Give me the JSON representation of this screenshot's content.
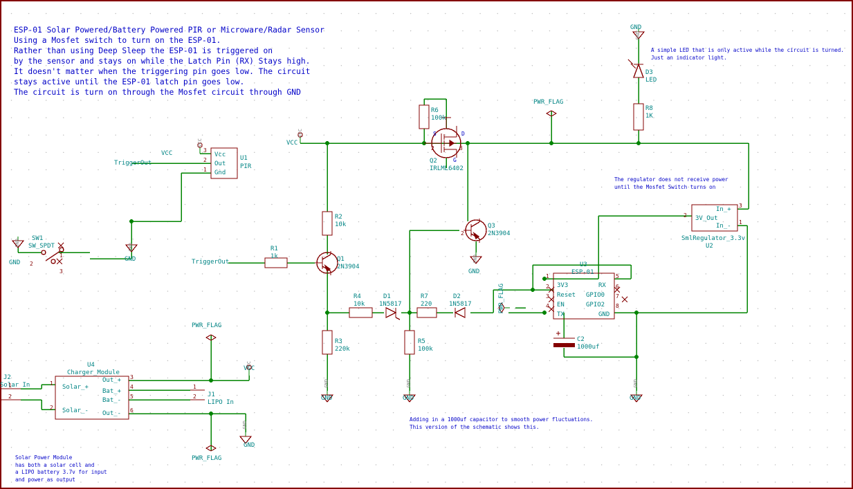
{
  "sheet": {
    "title_block": "ESP-01 Solar Powered/Battery Powered PIR or Microware/Radar Sensor\nUsing a Mosfet switch to turn on the ESP-01.\nRather than using Deep Sleep the ESP-01 is triggered on\nby the sensor and stays on while the Latch Pin (RX) Stays high.\nIt doesn't matter when the triggering pin goes low. The circuit\nstays active until the ESP-01 latch pin goes low.\nThe circuit is turn on through the Mosfet circuit through GND",
    "colors": {
      "wire": "#008400",
      "component": "#840000",
      "label": "#008484",
      "note": "#0000c8",
      "ground_gray": "#808080",
      "background": "#ffffff"
    }
  },
  "notes": {
    "led_note": "A simple LED that is only active while the circuit is turned.\nJust an indicator light.",
    "regulator_note": "The regulator does not receive power\nuntil the Mosfet Switch turns on",
    "capacitor_note": "Adding in a 1000uf capacitor to smooth power fluctuations.\nThis version of the schematic shows this.",
    "solar_note": "Solar Power Module\nhas both a solar cell and\na LIPO battery 3.7v for input\nand power as output"
  },
  "components": {
    "u1": {
      "ref": "U1",
      "value": "PIR",
      "pins": [
        "Vcc",
        "Out",
        "Gnd"
      ],
      "pin_numbers": [
        "3",
        "2",
        "1"
      ]
    },
    "u2": {
      "ref": "U2",
      "value": "SmlRegulator_3.3v",
      "pins": [
        "3V_Out",
        "In_+",
        "In_-"
      ],
      "pin_numbers": [
        "2",
        "3",
        "1"
      ]
    },
    "u3": {
      "ref": "U3",
      "value": "ESP-01",
      "pins_left": [
        "3V3",
        "Reset",
        "EN",
        "TX"
      ],
      "pins_left_numbers": [
        "1",
        "2",
        "3",
        "4"
      ],
      "pins_right": [
        "RX",
        "GPIO0",
        "GPIO2",
        "GND"
      ],
      "pins_right_numbers": [
        "5",
        "6",
        "7",
        "8"
      ]
    },
    "u4": {
      "ref": "U4",
      "value": "Charger_Module",
      "pins_left": [
        "Solar_+",
        "Solar_-"
      ],
      "pins_left_numbers": [
        "1",
        "2"
      ],
      "pins_right": [
        "Out_+",
        "Bat_+",
        "Bat_-",
        "Out_-"
      ],
      "pins_right_numbers": [
        "3",
        "4",
        "5",
        "6"
      ]
    },
    "j1": {
      "ref": "J1",
      "value": "LIPO In",
      "pin_numbers": [
        "1",
        "2"
      ]
    },
    "j2": {
      "ref": "J2",
      "value": "Solar In",
      "pin_numbers": [
        "1",
        "2"
      ]
    },
    "sw1": {
      "ref": "SW1",
      "value": "SW_SPDT",
      "pin_numbers": [
        "1",
        "2",
        "3"
      ]
    },
    "q1": {
      "ref": "Q1",
      "value": "2N3904"
    },
    "q2": {
      "ref": "Q2",
      "value": "IRLML6402",
      "pin_s": "S",
      "pin_d": "D",
      "pin_g": "G",
      "pin_numbers": [
        "2",
        "3"
      ]
    },
    "q3": {
      "ref": "Q3",
      "value": "2N3904",
      "pin_numbers": [
        "2"
      ]
    },
    "d1": {
      "ref": "D1",
      "value": "1N5817"
    },
    "d2": {
      "ref": "D2",
      "value": "1N5817"
    },
    "d3": {
      "ref": "D3",
      "value": "LED"
    },
    "c2": {
      "ref": "C2",
      "value": "1000uf"
    },
    "r1": {
      "ref": "R1",
      "value": "1k"
    },
    "r2": {
      "ref": "R2",
      "value": "10k"
    },
    "r3": {
      "ref": "R3",
      "value": "220k"
    },
    "r4": {
      "ref": "R4",
      "value": "10k"
    },
    "r5": {
      "ref": "R5",
      "value": "100k"
    },
    "r6": {
      "ref": "R6",
      "value": "100k"
    },
    "r7": {
      "ref": "R7",
      "value": "220"
    },
    "r8": {
      "ref": "R8",
      "value": "1K"
    }
  },
  "nets": {
    "trigger_out_1": "TriggerOut",
    "trigger_out_2": "TriggerOut",
    "vcc_pir": "VCC",
    "vcc_pir_sym": "VCC",
    "vcc_main": "VCC",
    "vcc_main_sym": "VCC",
    "vcc_charger": "VCC",
    "pwr_flag_top": "PWR_FLAG",
    "pwr_flag_esp": "PWR_FLAG",
    "pwr_flag_mid": "PWR_FLAG",
    "pwr_flag_bottom": "PWR_FLAG",
    "gnd_led": "GND",
    "gnd_sw": "GND",
    "gnd_pir": "GND",
    "gnd_q3": "GND",
    "gnd_r3": "GND",
    "gnd_r5": "GND",
    "gnd_esp": "GND",
    "gnd_charger": "GND",
    "gnd_sym_text": "GND"
  }
}
